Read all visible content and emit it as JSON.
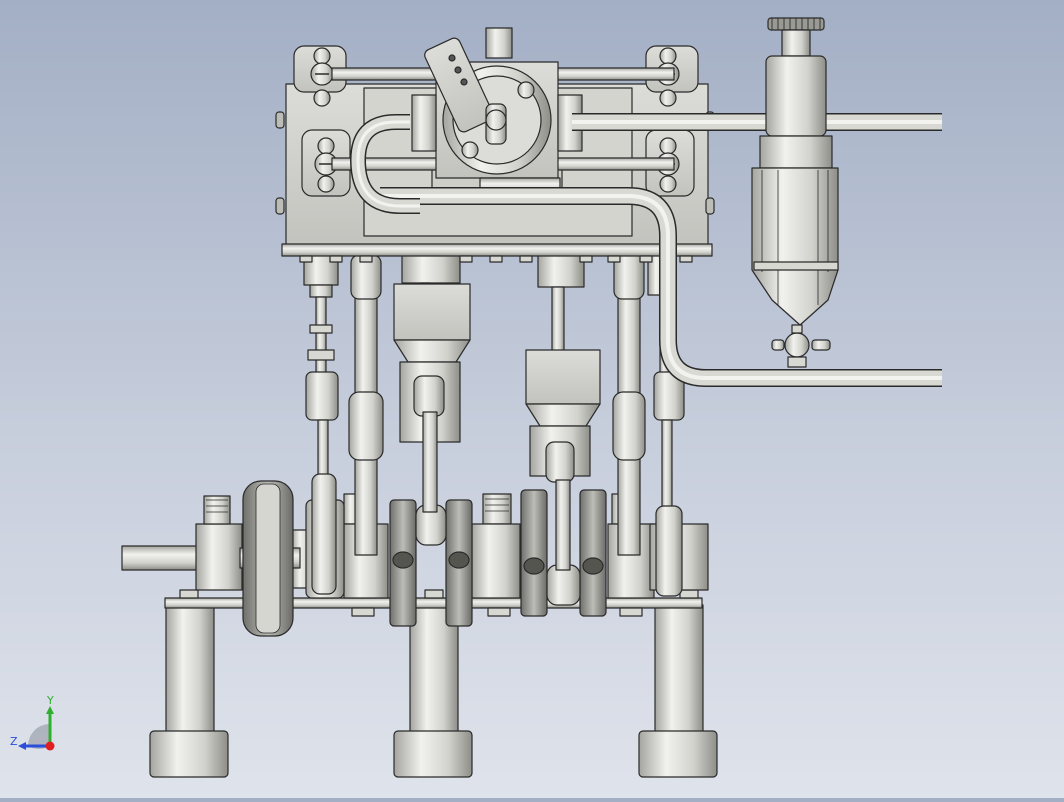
{
  "viewport": {
    "background_top": "#a3afc5",
    "background_bottom": "#dfe3eb",
    "model": "twin-cylinder-steam-engine",
    "view": "front"
  },
  "triad": {
    "y_label": "Y",
    "z_label": "Z",
    "y_color": "#2fae2f",
    "z_color": "#2b4fd8",
    "x_color": "#e02020"
  },
  "colors": {
    "metal_light": "#e8e8e4",
    "metal_mid": "#c9c9c4",
    "metal_dark": "#8d8d88",
    "edge": "#2a2a2a"
  }
}
